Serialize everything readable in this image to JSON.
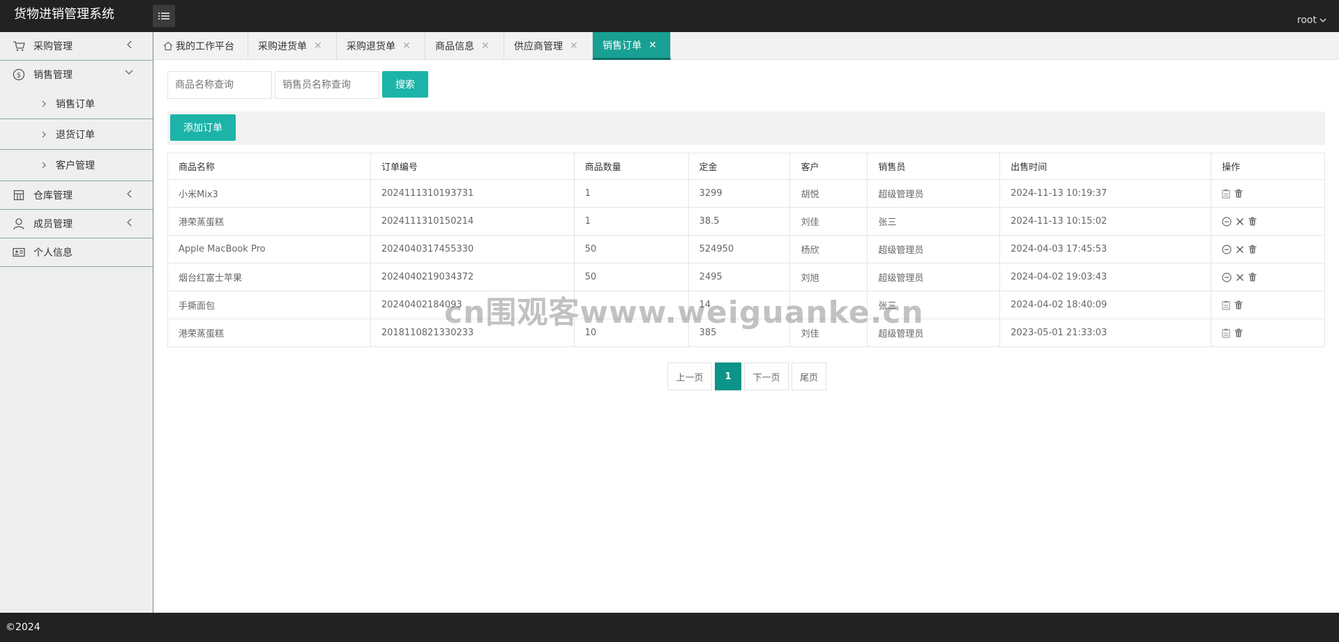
{
  "app": {
    "title": "货物进销管理系统",
    "user": "root"
  },
  "sidebar": {
    "groups": [
      {
        "label": "采购管理",
        "icon": "cart-icon"
      },
      {
        "label": "销售管理",
        "icon": "dollar-icon",
        "children": [
          "销售订单",
          "退货订单",
          "客户管理"
        ]
      },
      {
        "label": "仓库管理",
        "icon": "warehouse-icon"
      },
      {
        "label": "成员管理",
        "icon": "user-icon"
      },
      {
        "label": "个人信息",
        "icon": "id-card-icon"
      }
    ]
  },
  "tabs": [
    {
      "label": "我的工作平台"
    },
    {
      "label": "采购进货单"
    },
    {
      "label": "采购退货单"
    },
    {
      "label": "商品信息"
    },
    {
      "label": "供应商管理"
    },
    {
      "label": "销售订单",
      "active": true
    }
  ],
  "search": {
    "product_placeholder": "商品名称查询",
    "seller_placeholder": "销售员名称查询",
    "button": "搜索"
  },
  "toolbar": {
    "add_button": "添加订单"
  },
  "table": {
    "headers": [
      "商品名称",
      "订单编号",
      "商品数量",
      "定金",
      "客户",
      "销售员",
      "出售时间",
      "操作"
    ],
    "rows": [
      {
        "name": "小米Mix3",
        "order_no": "2024111310193731",
        "qty": "1",
        "deposit": "3299",
        "customer": "胡悦",
        "seller": "超级管理员",
        "time": "2024-11-13 10:19:37",
        "ops": [
          "edit",
          "delete"
        ]
      },
      {
        "name": "港荣蒸蛋糕",
        "order_no": "2024111310150214",
        "qty": "1",
        "deposit": "38.5",
        "customer": "刘佳",
        "seller": "张三",
        "time": "2024-11-13 10:15:02",
        "ops": [
          "minus",
          "cancel",
          "delete"
        ]
      },
      {
        "name": "Apple MacBook Pro",
        "order_no": "2024040317455330",
        "qty": "50",
        "deposit": "524950",
        "customer": "杨欣",
        "seller": "超级管理员",
        "time": "2024-04-03 17:45:53",
        "ops": [
          "minus",
          "cancel",
          "delete"
        ]
      },
      {
        "name": "烟台红富士苹果",
        "order_no": "2024040219034372",
        "qty": "50",
        "deposit": "2495",
        "customer": "刘旭",
        "seller": "超级管理员",
        "time": "2024-04-02 19:03:43",
        "ops": [
          "minus",
          "cancel",
          "delete"
        ]
      },
      {
        "name": "手撕面包",
        "order_no": "20240402184093",
        "qty": "",
        "deposit": "14",
        "customer": "",
        "seller": "张三",
        "time": "2024-04-02 18:40:09",
        "ops": [
          "edit",
          "delete"
        ]
      },
      {
        "name": "港荣蒸蛋糕",
        "order_no": "2018110821330233",
        "qty": "10",
        "deposit": "385",
        "customer": "刘佳",
        "seller": "超级管理员",
        "time": "2023-05-01 21:33:03",
        "ops": [
          "edit",
          "delete"
        ]
      }
    ]
  },
  "pager": {
    "prev": "上一页",
    "current": "1",
    "next": "下一页",
    "last": "尾页"
  },
  "footer": {
    "copyright": "©2024"
  },
  "watermark": "cn围观客www.weiguanke.cn",
  "colors": {
    "accent": "#1cb4a8",
    "active_tab": "#17a093",
    "topbar": "#222222"
  }
}
